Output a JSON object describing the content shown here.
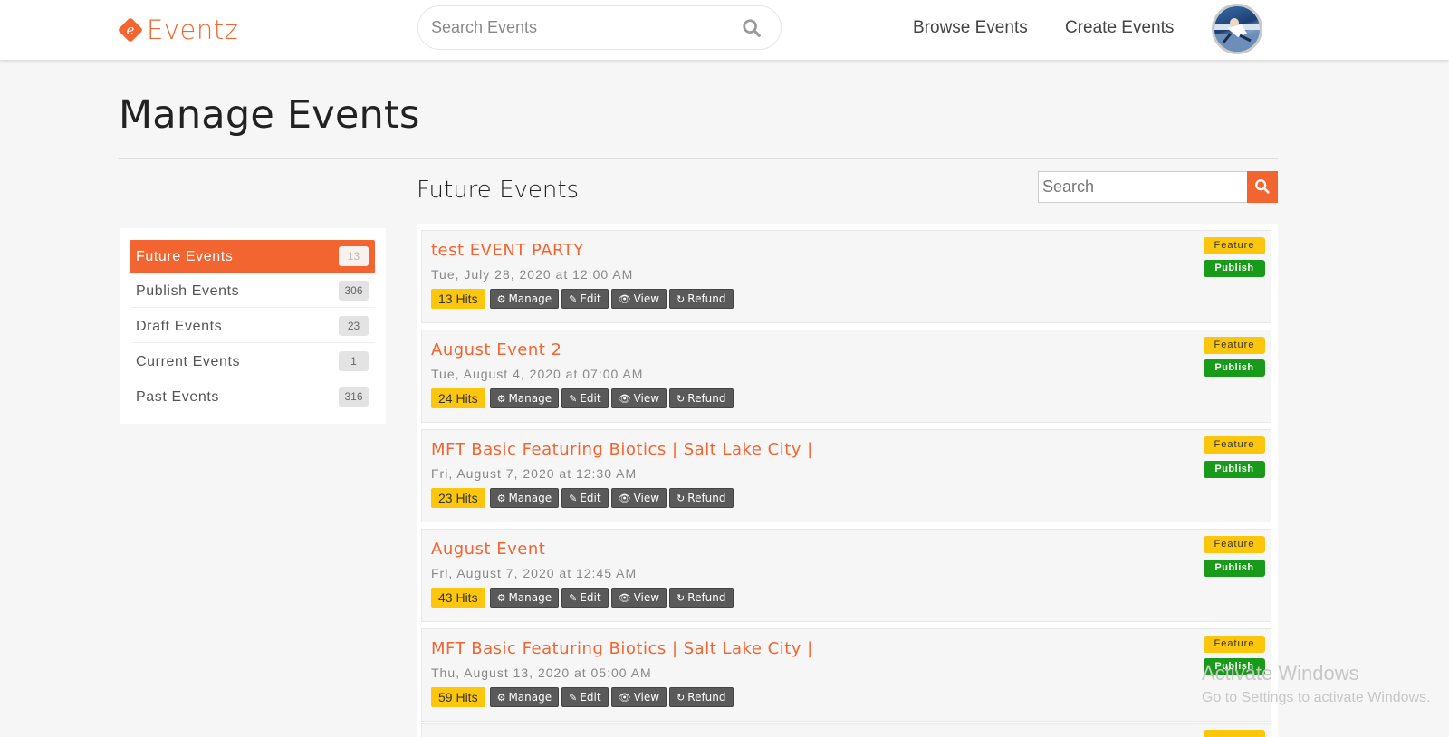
{
  "header": {
    "logo_text": "Eventz",
    "logo_mark": "e",
    "search_placeholder": "Search Events",
    "nav": {
      "browse": "Browse Events",
      "create": "Create Events"
    }
  },
  "page": {
    "title": "Manage Events"
  },
  "sidebar": {
    "items": [
      {
        "label": "Future Events",
        "count": "13",
        "active": true
      },
      {
        "label": "Publish Events",
        "count": "306"
      },
      {
        "label": "Draft Events",
        "count": "23"
      },
      {
        "label": "Current Events",
        "count": "1"
      },
      {
        "label": "Past Events",
        "count": "316"
      }
    ]
  },
  "main": {
    "section_title": "Future Events",
    "search_placeholder": "Search",
    "action_labels": {
      "manage": "Manage",
      "edit": "Edit",
      "view": "View",
      "refund": "Refund"
    },
    "badges": {
      "feature": "Feature",
      "publish": "Publish"
    },
    "events": [
      {
        "title": "test EVENT PARTY",
        "date": "Tue, July 28, 2020 at 12:00 AM",
        "hits": "13 Hits"
      },
      {
        "title": "August Event 2",
        "date": "Tue, August 4, 2020 at 07:00 AM",
        "hits": "24 Hits"
      },
      {
        "title": "MFT Basic Featuring Biotics | Salt Lake City |",
        "date": "Fri, August 7, 2020 at 12:30 AM",
        "hits": "23 Hits"
      },
      {
        "title": "August Event",
        "date": "Fri, August 7, 2020 at 12:45 AM",
        "hits": "43 Hits"
      },
      {
        "title": "MFT Basic Featuring Biotics | Salt Lake City |",
        "date": "Thu, August 13, 2020 at 05:00 AM",
        "hits": "59 Hits"
      }
    ]
  },
  "watermark": {
    "line1": "Activate Windows",
    "line2": "Go to Settings to activate Windows."
  },
  "colors": {
    "accent": "#f26531",
    "feature": "#fcc60c",
    "publish": "#1a9a1a",
    "action": "#5a5a5a"
  }
}
